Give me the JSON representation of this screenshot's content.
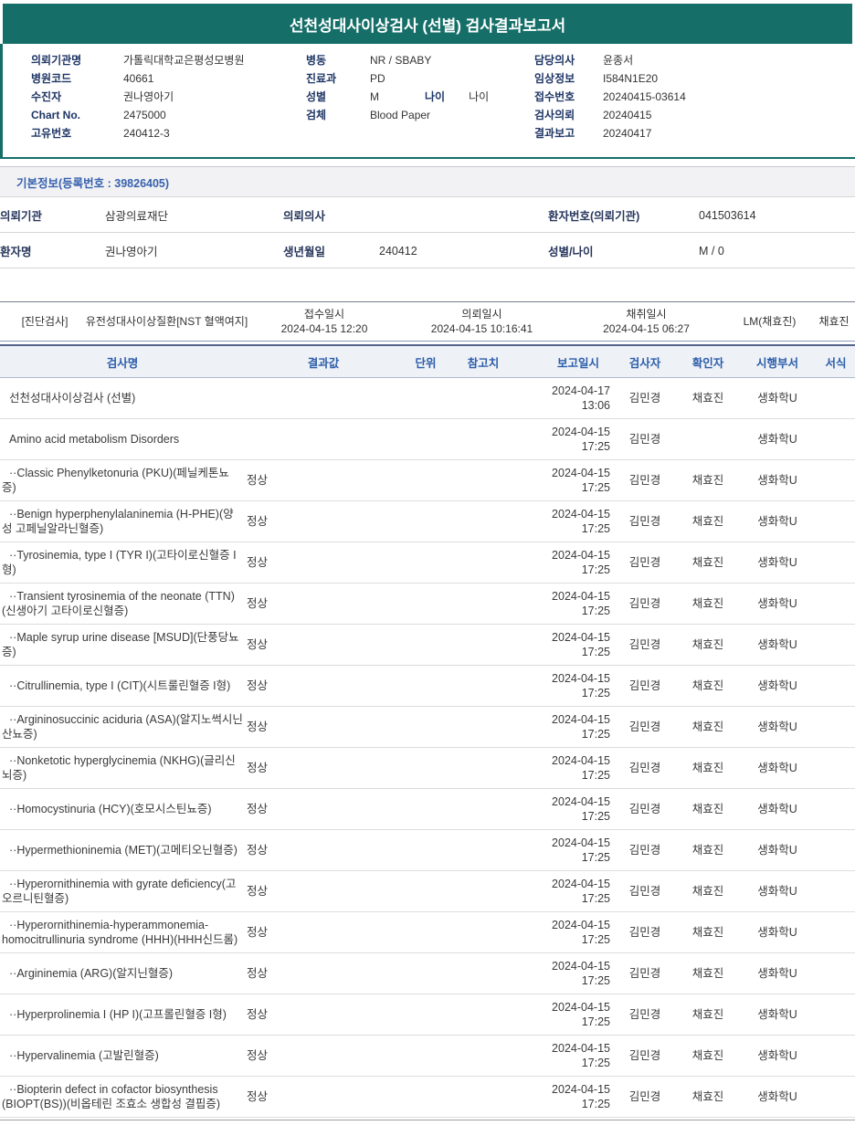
{
  "report": {
    "title": "선천성대사이상검사 (선별) 검사결과보고서"
  },
  "header_info": {
    "left": [
      {
        "label": "의뢰기관명",
        "value": "가톨릭대학교은평성모병원"
      },
      {
        "label": "병원코드",
        "value": "40661"
      },
      {
        "label": "수진자",
        "value": "권나영아기"
      },
      {
        "label": "Chart No.",
        "value": "2475000"
      },
      {
        "label": "고유번호",
        "value": "240412-3"
      }
    ],
    "middle": [
      {
        "label": "병동",
        "value": "NR / SBABY"
      },
      {
        "label": "진료과",
        "value": "PD"
      },
      {
        "label": "성별",
        "value": "M"
      },
      {
        "label": "검체",
        "value": "Blood Paper"
      }
    ],
    "age": {
      "label": "나이",
      "value": "나이"
    },
    "right": [
      {
        "label": "담당의사",
        "value": "윤종서"
      },
      {
        "label": "임상정보",
        "value": "I584N1E20"
      },
      {
        "label": "접수번호",
        "value": "20240415-03614"
      },
      {
        "label": "검사의뢰",
        "value": "20240415"
      },
      {
        "label": "결과보고",
        "value": "20240417"
      }
    ]
  },
  "basic_info": {
    "title": "기본정보(등록번호 : 39826405)",
    "row1": {
      "c1_label": "의뢰기관",
      "c1_value": "삼광의료재단",
      "c2_label": "의뢰의사",
      "c2_value": "",
      "c3_label": "환자번호(의뢰기관)",
      "c3_value": "041503614"
    },
    "row2": {
      "c1_label": "환자명",
      "c1_value": "권나영아기",
      "c2_label": "생년월일",
      "c2_value": "240412",
      "c3_label": "성별/나이",
      "c3_value": "M / 0"
    }
  },
  "diagnostic": {
    "tag": "[진단검사]",
    "test_group": "유전성대사이상질환[NST 혈액여지]",
    "receipt_label": "접수일시",
    "receipt_value": "2024-04-15 12:20",
    "request_label": "의뢰일시",
    "request_value": "2024-04-15 10:16:41",
    "collect_label": "채취일시",
    "collect_value": "2024-04-15 06:27",
    "collector": "LM(채효진)",
    "collector2": "채효진"
  },
  "results": {
    "headers": [
      "검사명",
      "결과값",
      "단위",
      "참고치",
      "보고일시",
      "검사자",
      "확인자",
      "시행부서",
      "서식"
    ],
    "rows": [
      {
        "name": "선천성대사이상검사 (선별)",
        "result": "",
        "date": "2024-04-17",
        "time": "13:06",
        "tester": "김민경",
        "confirmer": "채효진",
        "dept": "생화학U"
      },
      {
        "name": "Amino acid metabolism Disorders",
        "result": "",
        "date": "2024-04-15",
        "time": "17:25",
        "tester": "김민경",
        "confirmer": "",
        "dept": "생화학U"
      },
      {
        "name": "··Classic Phenylketonuria (PKU)(페닐케톤뇨증)",
        "result": "정상",
        "date": "2024-04-15",
        "time": "17:25",
        "tester": "김민경",
        "confirmer": "채효진",
        "dept": "생화학U"
      },
      {
        "name": "··Benign hyperphenylalaninemia (H-PHE)(양성 고페닐알라닌혈증)",
        "result": "정상",
        "date": "2024-04-15",
        "time": "17:25",
        "tester": "김민경",
        "confirmer": "채효진",
        "dept": "생화학U"
      },
      {
        "name": "··Tyrosinemia, type I (TYR I)(고타이로신혈증 I형)",
        "result": "정상",
        "date": "2024-04-15",
        "time": "17:25",
        "tester": "김민경",
        "confirmer": "채효진",
        "dept": "생화학U"
      },
      {
        "name": "··Transient tyrosinemia of the neonate (TTN)(신생아기 고타이로신혈증)",
        "result": "정상",
        "date": "2024-04-15",
        "time": "17:25",
        "tester": "김민경",
        "confirmer": "채효진",
        "dept": "생화학U"
      },
      {
        "name": "··Maple syrup urine disease [MSUD](단풍당뇨증)",
        "result": "정상",
        "date": "2024-04-15",
        "time": "17:25",
        "tester": "김민경",
        "confirmer": "채효진",
        "dept": "생화학U"
      },
      {
        "name": "··Citrullinemia, type I (CIT)(시트룰린혈증 I형)",
        "result": "정상",
        "date": "2024-04-15",
        "time": "17:25",
        "tester": "김민경",
        "confirmer": "채효진",
        "dept": "생화학U"
      },
      {
        "name": "··Argininosuccinic aciduria (ASA)(알지노썩시닌산뇨증)",
        "result": "정상",
        "date": "2024-04-15",
        "time": "17:25",
        "tester": "김민경",
        "confirmer": "채효진",
        "dept": "생화학U"
      },
      {
        "name": "··Nonketotic hyperglycinemia (NKHG)(글리신뇌증)",
        "result": "정상",
        "date": "2024-04-15",
        "time": "17:25",
        "tester": "김민경",
        "confirmer": "채효진",
        "dept": "생화학U"
      },
      {
        "name": "··Homocystinuria (HCY)(호모시스틴뇨증)",
        "result": "정상",
        "date": "2024-04-15",
        "time": "17:25",
        "tester": "김민경",
        "confirmer": "채효진",
        "dept": "생화학U"
      },
      {
        "name": "··Hypermethioninemia (MET)(고메티오닌혈증)",
        "result": "정상",
        "date": "2024-04-15",
        "time": "17:25",
        "tester": "김민경",
        "confirmer": "채효진",
        "dept": "생화학U"
      },
      {
        "name": "··Hyperornithinemia with gyrate deficiency(고오르니틴혈증)",
        "result": "정상",
        "date": "2024-04-15",
        "time": "17:25",
        "tester": "김민경",
        "confirmer": "채효진",
        "dept": "생화학U"
      },
      {
        "name": "··Hyperornithinemia-hyperammonemia-homocitrullinuria syndrome (HHH)(HHH신드롬)",
        "result": "정상",
        "date": "2024-04-15",
        "time": "17:25",
        "tester": "김민경",
        "confirmer": "채효진",
        "dept": "생화학U"
      },
      {
        "name": "··Argininemia (ARG)(알지닌혈증)",
        "result": "정상",
        "date": "2024-04-15",
        "time": "17:25",
        "tester": "김민경",
        "confirmer": "채효진",
        "dept": "생화학U"
      },
      {
        "name": "··Hyperprolinemia I (HP I)(고프롤린혈증 I형)",
        "result": "정상",
        "date": "2024-04-15",
        "time": "17:25",
        "tester": "김민경",
        "confirmer": "채효진",
        "dept": "생화학U"
      },
      {
        "name": "··Hypervalinemia (고발린혈증)",
        "result": "정상",
        "date": "2024-04-15",
        "time": "17:25",
        "tester": "김민경",
        "confirmer": "채효진",
        "dept": "생화학U"
      },
      {
        "name": "··Biopterin defect in cofactor biosynthesis (BIOPT(BS))(비옵테린 조효소 생합성 결핍증)",
        "result": "정상",
        "date": "2024-04-15",
        "time": "17:25",
        "tester": "김민경",
        "confirmer": "채효진",
        "dept": "생화학U"
      }
    ]
  }
}
